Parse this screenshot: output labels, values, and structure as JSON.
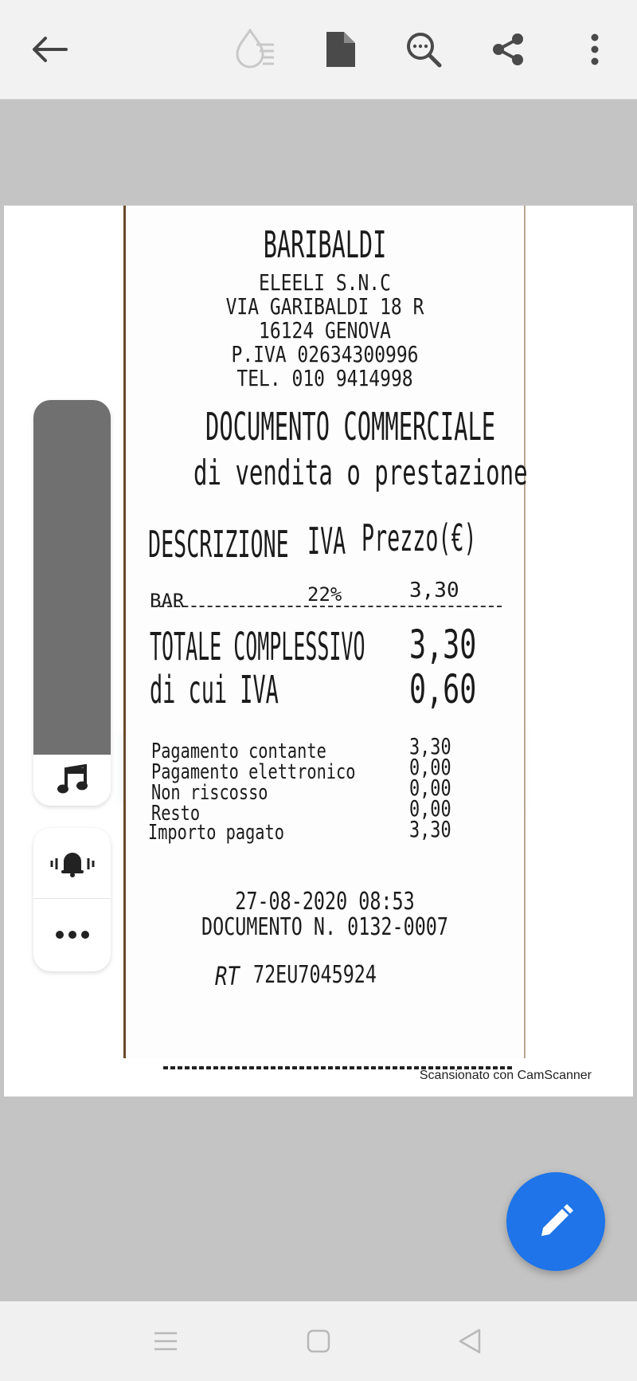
{
  "toolbar": {
    "icons": [
      "back-arrow-icon",
      "watermark-drop-icon",
      "document-icon",
      "search-more-icon",
      "share-icon",
      "more-vert-icon"
    ]
  },
  "receipt": {
    "shop_name": "BARIBALDI",
    "company": "ELEELI S.N.C",
    "address": "VIA GARIBALDI 18 R",
    "city": "16124 GENOVA",
    "vat_number": "P.IVA 02634300996",
    "phone": "TEL. 010 9414998",
    "doc_title": "DOCUMENTO COMMERCIALE",
    "doc_subtitle": "di vendita o prestazione",
    "col_description": "DESCRIZIONE",
    "col_vat": "IVA",
    "col_price": "Prezzo(€)",
    "item": {
      "name": "BAR",
      "vat": "22%",
      "price": "3,30"
    },
    "total_label": "TOTALE COMPLESSIVO",
    "total_value": "3,30",
    "vat_label": "di cui IVA",
    "vat_value": "0,60",
    "payments": [
      {
        "label": "Pagamento contante",
        "value": "3,30"
      },
      {
        "label": "Pagamento elettronico",
        "value": "0,00"
      },
      {
        "label": "Non riscosso",
        "value": "0,00"
      },
      {
        "label": "Resto",
        "value": "0,00"
      },
      {
        "label": "Importo pagato",
        "value": "3,30"
      }
    ],
    "datetime": "27-08-2020  08:53",
    "doc_number": "DOCUMENTO N. 0132-0007",
    "rt_code": "72EU7045924",
    "rt_prefix": "RT"
  },
  "watermark": "Scansionato con CamScanner",
  "side_panel": {
    "icons": [
      "music-note-icon",
      "vibrate-bell-icon",
      "more-horiz-icon"
    ]
  },
  "fab": {
    "icon": "edit-pencil-icon",
    "color": "#1e74e8"
  },
  "navbar": {
    "icons": [
      "recents-icon",
      "home-icon",
      "back-triangle-icon"
    ]
  }
}
